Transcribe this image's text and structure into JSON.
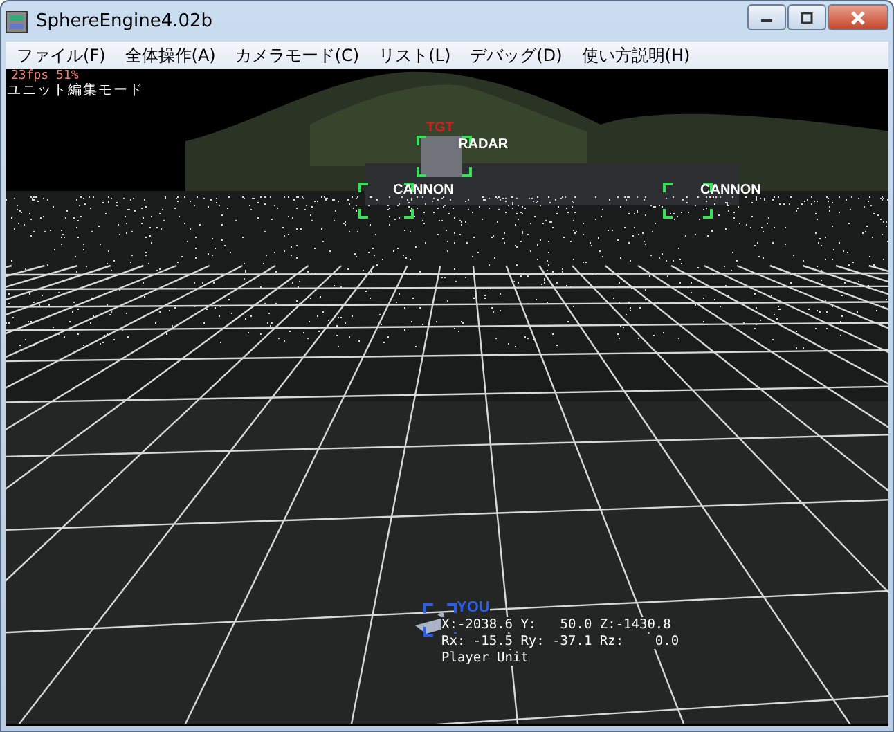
{
  "window": {
    "title": "SphereEngine4.02b"
  },
  "menu": [
    "ファイル(F)",
    "全体操作(A)",
    "カメラモード(C)",
    "リスト(L)",
    "デバッグ(D)",
    "使い方説明(H)"
  ],
  "hud": {
    "stats": "23fps  51%",
    "mode": "ユニット編集モード"
  },
  "targets": [
    {
      "label": "TGT",
      "kind": "tgt"
    },
    {
      "label": "RADAR",
      "kind": "unit"
    },
    {
      "label": "CANNON",
      "kind": "unit"
    },
    {
      "label": "CANNON",
      "kind": "unit"
    }
  ],
  "player": {
    "label": "YOU",
    "lines": [
      "X:-2038.6 Y:   50.0 Z:-1430.8",
      "Rx: -15.5 Ry: -37.1 Rz:    0.0",
      "Player Unit"
    ]
  }
}
